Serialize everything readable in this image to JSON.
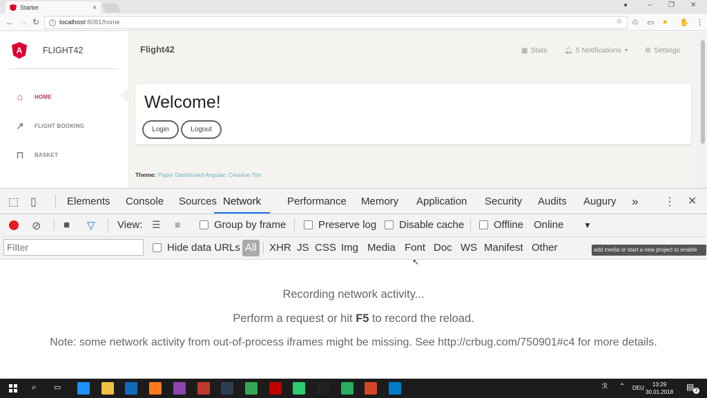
{
  "browser": {
    "tab_title": "Starter",
    "tab_close": "×",
    "url_host": "localhost",
    "url_path": ":8081/home"
  },
  "app": {
    "brand": "FLIGHT42",
    "page_title": "Flight42",
    "logo_letter": "A",
    "sidebar": [
      {
        "label": "HOME",
        "icon": "home-icon",
        "active": true
      },
      {
        "label": "FLIGHT BOOKING",
        "icon": "arrow-up-right-icon",
        "active": false
      },
      {
        "label": "BASKET",
        "icon": "cart-icon",
        "active": false
      }
    ],
    "topnav": {
      "stats": "Stats",
      "notifications": "5 Notifications",
      "settings": "Settings"
    },
    "welcome": "Welcome!",
    "login": "Login",
    "logout": "Logout",
    "theme_label": "Theme:",
    "theme_link": "Paper Dashboard Angular, Creative Tim"
  },
  "devtools": {
    "tabs": [
      "Elements",
      "Console",
      "Sources",
      "Network",
      "Performance",
      "Memory",
      "Application",
      "Security",
      "Audits",
      "Augury"
    ],
    "active_tab": "Network",
    "more": "»",
    "close": "✕",
    "toolbar": {
      "view_label": "View:",
      "group_by_frame": "Group by frame",
      "preserve_log": "Preserve log",
      "disable_cache": "Disable cache",
      "offline": "Offline",
      "throttle": "Online"
    },
    "filter": {
      "placeholder": "Filter",
      "hide_data_urls": "Hide data URLs",
      "types": [
        "All",
        "XHR",
        "JS",
        "CSS",
        "Img",
        "Media",
        "Font",
        "Doc",
        "WS",
        "Manifest",
        "Other"
      ],
      "tooltip": "add media or start a new project to enable"
    },
    "messages": {
      "recording": "Recording network activity...",
      "perform_pre": "Perform a request or hit ",
      "perform_key": "F5",
      "perform_post": " to record the reload.",
      "note": "Note: some network activity from out-of-process iframes might be missing. See http://crbug.com/750901#c4 for more details."
    }
  },
  "taskbar": {
    "lang": "DEU",
    "time": "13:29",
    "date": "30.01.2018",
    "notif_count": "3",
    "apps": [
      {
        "name": "edge",
        "color": "#1e90ff"
      },
      {
        "name": "explorer",
        "color": "#f0c040"
      },
      {
        "name": "outlook",
        "color": "#0f6cbd"
      },
      {
        "name": "firefox",
        "color": "#ff7a1a"
      },
      {
        "name": "visual-studio",
        "color": "#8e44ad"
      },
      {
        "name": "filezilla-like",
        "color": "#c0392b"
      },
      {
        "name": "webstorm",
        "color": "#2c3e50"
      },
      {
        "name": "chrome",
        "color": "#34a853"
      },
      {
        "name": "filezilla",
        "color": "#bf0000"
      },
      {
        "name": "sourcetree",
        "color": "#2ecc71"
      },
      {
        "name": "terminal",
        "color": "#222222"
      },
      {
        "name": "git-app",
        "color": "#27ae60"
      },
      {
        "name": "powerpoint",
        "color": "#d24726"
      },
      {
        "name": "vscode",
        "color": "#007acc"
      }
    ]
  }
}
